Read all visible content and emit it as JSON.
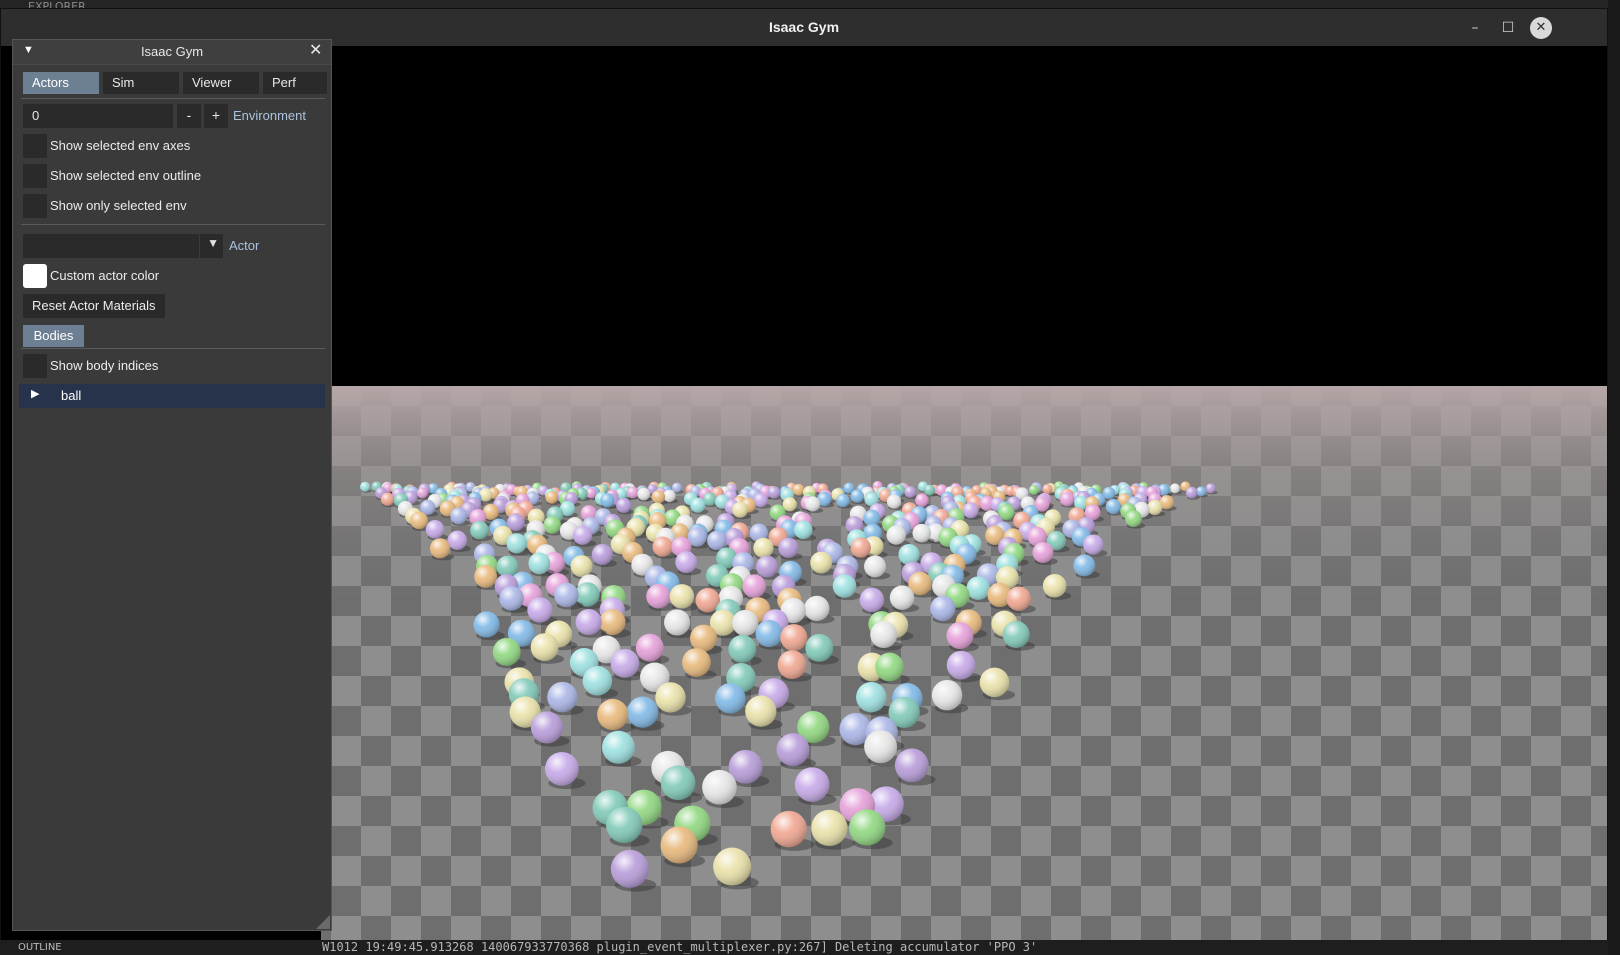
{
  "window": {
    "title": "Isaac Gym"
  },
  "panel": {
    "title": "Isaac Gym",
    "tabs": [
      {
        "label": "Actors",
        "active": true
      },
      {
        "label": "Sim",
        "active": false
      },
      {
        "label": "Viewer",
        "active": false
      },
      {
        "label": "Perf",
        "active": false
      }
    ],
    "environment": {
      "value": "0",
      "minus_label": "-",
      "plus_label": "+",
      "label": "Environment"
    },
    "checkboxes": [
      {
        "label": "Show selected env axes",
        "checked": false
      },
      {
        "label": "Show selected env outline",
        "checked": false
      },
      {
        "label": "Show only selected env",
        "checked": false
      }
    ],
    "actor": {
      "value": "",
      "label": "Actor"
    },
    "custom_color": {
      "label": "Custom actor color",
      "color": "#ffffff"
    },
    "reset_button": "Reset Actor Materials",
    "bodies_tab": "Bodies",
    "show_body_indices": "Show body indices",
    "tree_item": "ball"
  },
  "background": {
    "top_tabs": "EXPLORER",
    "bottom_left": "OUTLINE",
    "log_line": "W1012 19:49:45.913268 140067933770368 plugin_event_multiplexer.py:267] Deleting accumulator 'PPO 3'"
  },
  "colors": {
    "accent_tab": "#6d7f93",
    "label_blue": "#aac2de",
    "selected_row": "#26334a",
    "panel_bg": "#3a3a3a"
  }
}
